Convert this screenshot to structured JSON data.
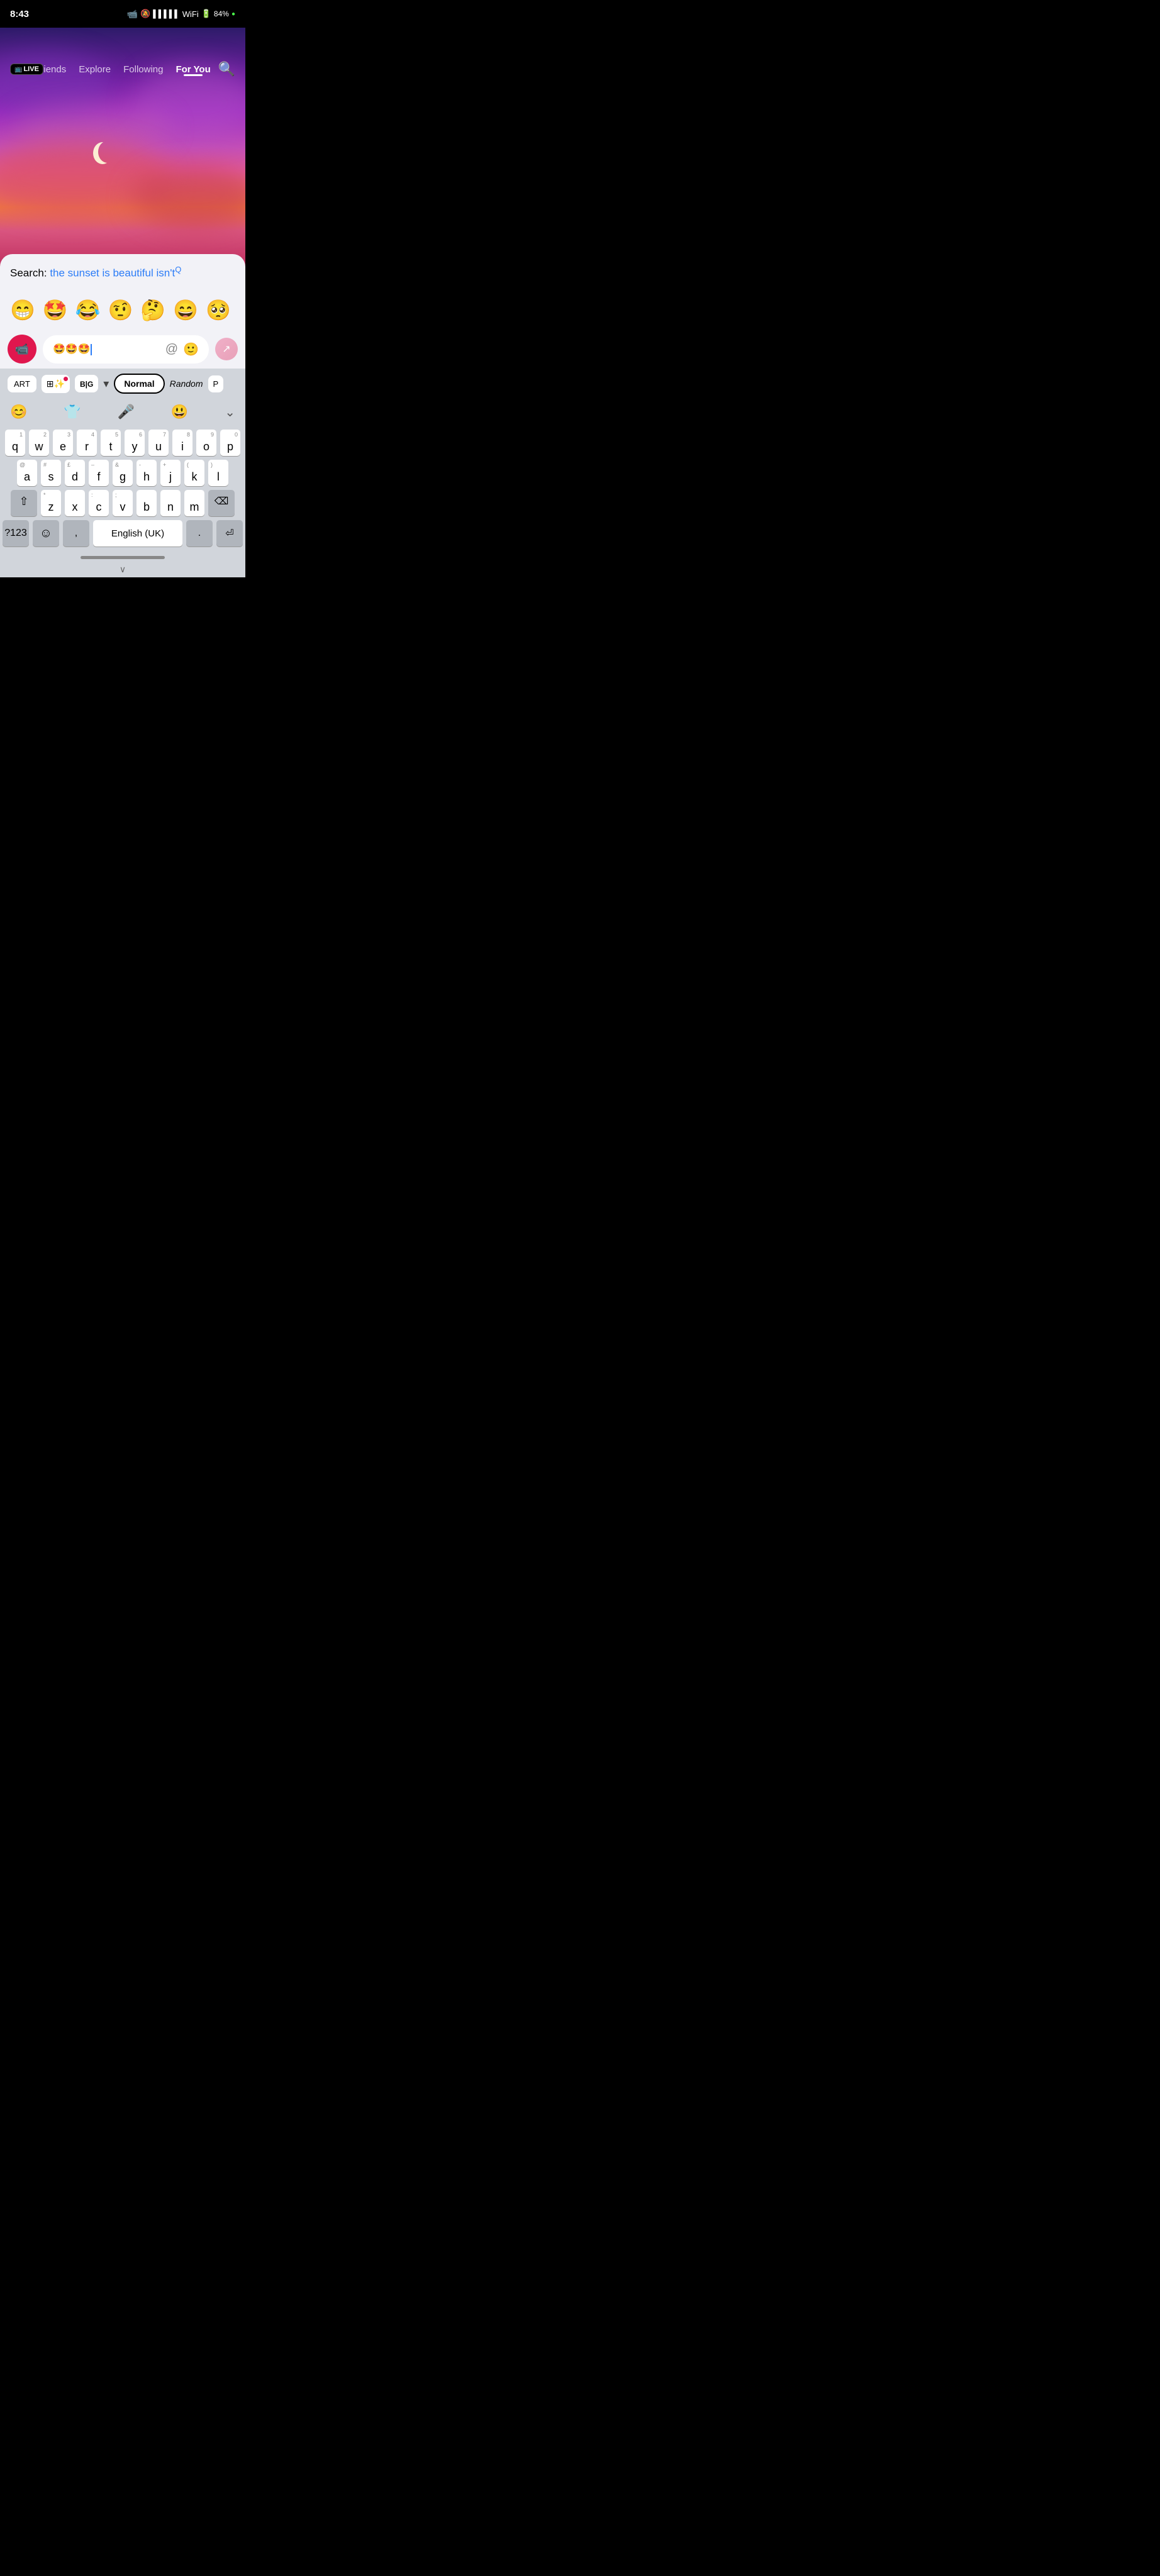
{
  "statusBar": {
    "time": "8:43",
    "battery": "84%",
    "batteryIcon": "🔋"
  },
  "navBar": {
    "liveBadge": "LIVE",
    "links": [
      "Friends",
      "Explore",
      "Following",
      "For You"
    ],
    "activeLink": "For You"
  },
  "searchPanel": {
    "label": "Search: ",
    "query": "the sunset is beautiful isn't",
    "queryMark": "Q"
  },
  "emojiRow": {
    "emojis": [
      "😁",
      "🤩",
      "😂",
      "🤨",
      "🤔",
      "😄",
      "🥺"
    ]
  },
  "inputRow": {
    "inputContent": "🤩🤩🤩",
    "atIcon": "@",
    "faceIcon": "🙂"
  },
  "keyboardToolbar": {
    "artLabel": "ART",
    "bigLabel": "BIG",
    "normalLabel": "Normal",
    "randomLabel": "Random"
  },
  "keyboard": {
    "row1": [
      {
        "letter": "q",
        "num": "1"
      },
      {
        "letter": "w",
        "num": "2"
      },
      {
        "letter": "e",
        "num": "3"
      },
      {
        "letter": "r",
        "num": "4"
      },
      {
        "letter": "t",
        "num": "5"
      },
      {
        "letter": "y",
        "num": "6"
      },
      {
        "letter": "u",
        "num": "7"
      },
      {
        "letter": "i",
        "num": "8"
      },
      {
        "letter": "o",
        "num": "9"
      },
      {
        "letter": "p",
        "num": "0"
      }
    ],
    "row2": [
      {
        "letter": "a",
        "sym": "@"
      },
      {
        "letter": "s",
        "sym": "#"
      },
      {
        "letter": "d",
        "sym": "£"
      },
      {
        "letter": "f",
        "sym": "–"
      },
      {
        "letter": "g",
        "sym": "&"
      },
      {
        "letter": "h",
        "sym": "-"
      },
      {
        "letter": "j",
        "sym": "+"
      },
      {
        "letter": "k",
        "sym": "("
      },
      {
        "letter": "l",
        "sym": ")"
      }
    ],
    "row3": [
      {
        "letter": "z",
        "sym": "*"
      },
      {
        "letter": "x"
      },
      {
        "letter": "c",
        "sym": ":"
      },
      {
        "letter": "v",
        "sym": ";"
      },
      {
        "letter": "b"
      },
      {
        "letter": "n"
      },
      {
        "letter": "m"
      }
    ],
    "bottomRow": {
      "numLabel": "?123",
      "emojiLabel": "☺",
      "commaLabel": ",",
      "spaceLabel": "English (UK)",
      "periodLabel": ".",
      "returnLabel": "⏎"
    }
  },
  "homeIndicator": {
    "chevron": "∨"
  }
}
